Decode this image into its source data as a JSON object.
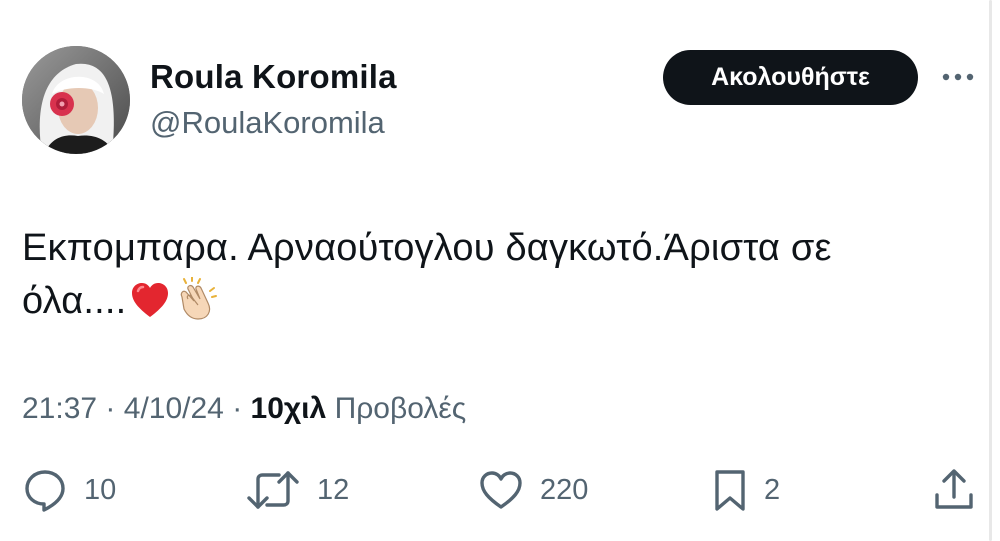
{
  "author": {
    "display_name": "Roula Koromila",
    "handle": "@RoulaKoromila"
  },
  "follow_button": {
    "label": "Ακολουθήστε"
  },
  "tweet": {
    "text": "Εκπομπαρα. Αρναούτογλου δαγκωτό.Άριστα σε όλα....",
    "emojis": [
      "red-heart",
      "clapping-hands"
    ]
  },
  "meta": {
    "time": "21:37",
    "separator": "·",
    "date": "4/10/24",
    "views_count": "10χιλ",
    "views_label": "Προβολές"
  },
  "actions": {
    "replies": "10",
    "reposts": "12",
    "likes": "220",
    "bookmarks": "2"
  },
  "colors": {
    "text": "#0f1419",
    "secondary": "#536471",
    "button_bg": "#0f1419",
    "button_text": "#ffffff"
  }
}
